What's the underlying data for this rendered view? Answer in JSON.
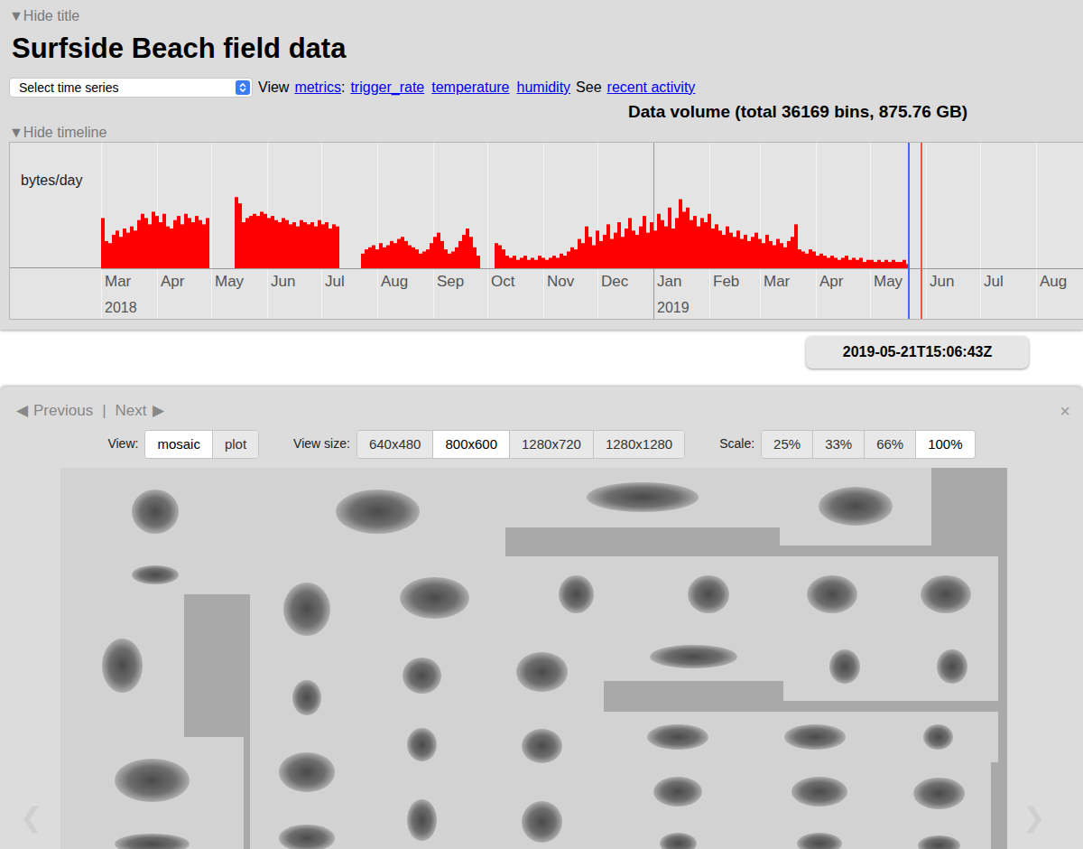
{
  "header": {
    "hide_title": "▼Hide title",
    "title": "Surfside Beach field data",
    "time_series_select": {
      "value": "Select time series"
    },
    "view_word": "View",
    "metrics_link": "metrics",
    "metrics_colon": ":",
    "metric_links": [
      "trigger_rate",
      "temperature",
      "humidity"
    ],
    "see_word": "See",
    "activity_link": "recent activity",
    "data_volume": "Data volume (total 36169 bins, 875.76 GB)",
    "hide_timeline": "▼Hide timeline"
  },
  "chart": {
    "y_label": "bytes/day",
    "bin_days": 2,
    "series": [
      {
        "values": [
          2400000000.0,
          1300000000.0,
          1200000000.0,
          1600000000.0,
          1800000000.0,
          1500000000.0,
          1900000000.0,
          1700000000.0,
          2000000000.0,
          1800000000.0,
          2300000000.0,
          2600000000.0,
          2400000000.0,
          2100000000.0,
          2700000000.0,
          2500000000.0,
          2200000000.0,
          2600000000.0,
          2000000000.0,
          1900000000.0,
          2300000000.0,
          2500000000.0,
          2100000000.0,
          2600000000.0,
          2400000000.0,
          2200000000.0,
          2500000000.0,
          2300000000.0,
          2100000000.0,
          2400000000.0,
          0,
          0,
          0,
          0,
          0,
          0,
          0,
          3400000000.0,
          3100000000.0,
          2200000000.0,
          2400000000.0,
          2500000000.0,
          2600000000.0,
          2500000000.0,
          2700000000.0,
          2600000000.0,
          2400000000.0,
          2500000000.0,
          2300000000.0,
          2200000000.0,
          2400000000.0,
          2300000000.0,
          2100000000.0,
          2200000000.0,
          2000000000.0,
          2300000000.0,
          2200000000.0,
          2100000000.0,
          2200000000.0,
          2000000000.0,
          2300000000.0,
          2100000000.0,
          2200000000.0,
          1900000000.0,
          2100000000.0,
          2000000000.0,
          0,
          0,
          0,
          0,
          0,
          0,
          700000000.0,
          900000000.0,
          1000000000.0,
          1100000000.0,
          900000000.0,
          1200000000.0,
          1000000000.0,
          1100000000.0,
          1300000000.0,
          1200000000.0,
          1400000000.0,
          1500000000.0,
          1300000000.0,
          1100000000.0,
          1000000000.0,
          900000000.0,
          700000000.0,
          800000000.0,
          900000000.0,
          1200000000.0,
          1500000000.0,
          1700000000.0,
          1300000000.0,
          900000000.0,
          700000000.0,
          800000000.0,
          1000000000.0,
          1300000000.0,
          1600000000.0,
          1900000000.0,
          1500000000.0,
          1000000000.0,
          600000000.0,
          0,
          0,
          0,
          0,
          1200000000.0,
          1100000000.0,
          900000000.0,
          600000000.0,
          500000000.0,
          600000000.0,
          400000000.0,
          500000000.0,
          600000000.0,
          400000000.0,
          500000000.0,
          400000000.0,
          600000000.0,
          500000000.0,
          400000000.0,
          500000000.0,
          600000000.0,
          500000000.0,
          700000000.0,
          600000000.0,
          800000000.0,
          1000000000.0,
          900000000.0,
          1400000000.0,
          1200000000.0,
          2000000000.0,
          1500000000.0,
          1100000000.0,
          1800000000.0,
          1300000000.0,
          1600000000.0,
          2100000000.0,
          1400000000.0,
          1700000000.0,
          2200000000.0,
          1500000000.0,
          1900000000.0,
          2400000000.0,
          1800000000.0,
          1600000000.0,
          2000000000.0,
          2500000000.0,
          1700000000.0,
          2200000000.0,
          1800000000.0,
          2600000000.0,
          2300000000.0,
          2000000000.0,
          2900000000.0,
          1900000000.0,
          2400000000.0,
          3300000000.0,
          2700000000.0,
          2900000000.0,
          2300000000.0,
          2500000000.0,
          2000000000.0,
          2400000000.0,
          2200000000.0,
          2600000000.0,
          1900000000.0,
          2100000000.0,
          1800000000.0,
          1600000000.0,
          2000000000.0,
          1700000000.0,
          1500000000.0,
          1800000000.0,
          1400000000.0,
          1600000000.0,
          1300000000.0,
          1500000000.0,
          1700000000.0,
          1400000000.0,
          1200000000.0,
          1600000000.0,
          1300000000.0,
          1100000000.0,
          1400000000.0,
          1200000000.0,
          1000000000.0,
          1300000000.0,
          1500000000.0,
          2100000000.0,
          900000000.0,
          800000000.0,
          700000000.0,
          900000000.0,
          800000000.0,
          600000000.0,
          700000000.0,
          600000000.0,
          500000000.0,
          600000000.0,
          500000000.0,
          400000000.0,
          500000000.0,
          600000000.0,
          400000000.0,
          500000000.0,
          400000000.0,
          500000000.0,
          300000000.0,
          400000000.0,
          400000000.0,
          300000000.0,
          400000000.0,
          300000000.0,
          400000000.0,
          300000000.0,
          400000000.0,
          300000000.0,
          300000000.0,
          400000000.0,
          200000000.0
        ]
      }
    ],
    "x_ticks": [
      {
        "label": "Mar",
        "day": 0
      },
      {
        "label": "Apr",
        "day": 31
      },
      {
        "label": "May",
        "day": 61
      },
      {
        "label": "Jun",
        "day": 92
      },
      {
        "label": "Jul",
        "day": 122
      },
      {
        "label": "Aug",
        "day": 153
      },
      {
        "label": "Sep",
        "day": 184
      },
      {
        "label": "Oct",
        "day": 214
      },
      {
        "label": "Nov",
        "day": 245
      },
      {
        "label": "Dec",
        "day": 275
      },
      {
        "label": "Jan",
        "day": 306
      },
      {
        "label": "Feb",
        "day": 337
      },
      {
        "label": "Mar",
        "day": 365
      },
      {
        "label": "Apr",
        "day": 396
      },
      {
        "label": "May",
        "day": 426
      },
      {
        "label": "Jun",
        "day": 457
      },
      {
        "label": "Jul",
        "day": 487
      },
      {
        "label": "Aug",
        "day": 518
      }
    ],
    "years": [
      {
        "label": "2018",
        "day": 0
      },
      {
        "label": "2019",
        "day": 306
      }
    ],
    "markers": [
      {
        "day": 447,
        "color": "#3b6ef5"
      },
      {
        "day": 454,
        "color": "#f0543c"
      }
    ]
  },
  "timestamp": "2019-05-21T15:06:43Z",
  "bin_nav": {
    "previous_icon": "◀",
    "previous": "Previous",
    "separator": "|",
    "next": "Next",
    "next_icon": "▶",
    "close": "×"
  },
  "toolbar": [
    {
      "label": "View:",
      "options": [
        {
          "label": "mosaic",
          "selected": true
        },
        {
          "label": "plot",
          "selected": false
        }
      ]
    },
    {
      "label": "View size:",
      "options": [
        {
          "label": "640x480",
          "selected": false
        },
        {
          "label": "800x600",
          "selected": true
        },
        {
          "label": "1280x720",
          "selected": false
        },
        {
          "label": "1280x1280",
          "selected": false
        }
      ]
    },
    {
      "label": "Scale:",
      "options": [
        {
          "label": "25%",
          "selected": false
        },
        {
          "label": "33%",
          "selected": false
        },
        {
          "label": "66%",
          "selected": false
        },
        {
          "label": "100%",
          "selected": true
        }
      ]
    }
  ],
  "mosaic": {
    "left_arrow": "❮",
    "right_arrow": "❯"
  }
}
